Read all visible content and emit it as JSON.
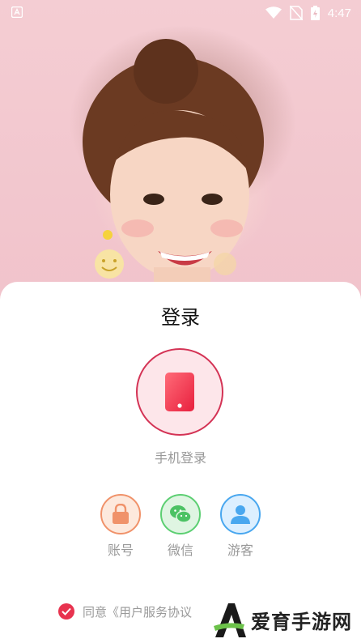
{
  "status_bar": {
    "time": "4:47",
    "icons": [
      "app-notification-icon",
      "wifi-icon",
      "no-sim-icon",
      "battery-charging-icon"
    ]
  },
  "login": {
    "title": "登录",
    "phone_login_label": "手机登录",
    "options": [
      {
        "label": "账号",
        "icon": "lock-icon"
      },
      {
        "label": "微信",
        "icon": "wechat-icon"
      },
      {
        "label": "游客",
        "icon": "user-icon"
      }
    ],
    "agreement_text": "同意《用户服务协议"
  },
  "watermark": {
    "text": "爱育手游网"
  },
  "colors": {
    "accent": "#e8334f",
    "phone_circle_bg": "#fde6ea",
    "account_orange": "#f0926a",
    "wechat_green": "#5ccf72",
    "guest_blue": "#49a7ef"
  }
}
